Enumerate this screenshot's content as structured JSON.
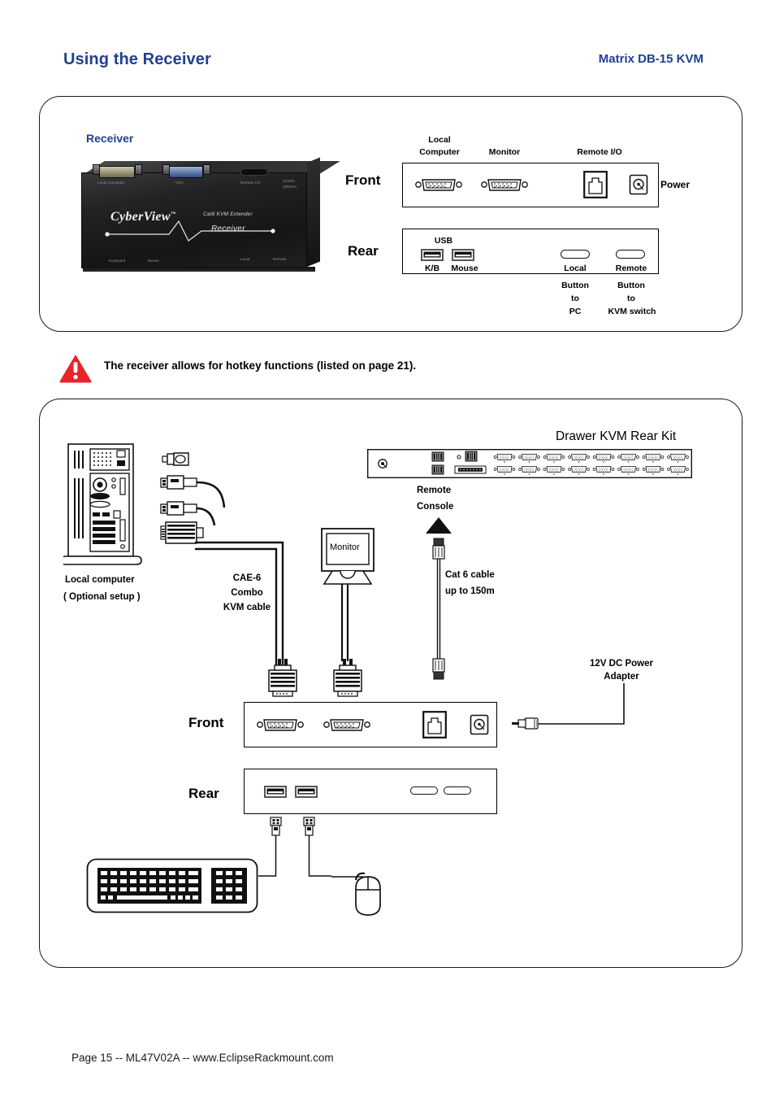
{
  "header": {
    "title": "Using the Receiver",
    "model": "Matrix  DB-15 KVM"
  },
  "receiver_section": {
    "label": "Receiver",
    "photo": {
      "brand": "CyberView",
      "trademark": "™",
      "product_line": "Cat6 KVM Extender",
      "unit_type": "Receiver",
      "port_labels": [
        "Local Computer",
        "VGA",
        "Remote I/O",
        "12VDC 1000mA",
        "K/B",
        "Mouse",
        "Local",
        "Remote"
      ]
    },
    "front": {
      "word": "Front",
      "labels": {
        "local_computer": "Local\nComputer",
        "local_computer_line1": "Local",
        "local_computer_line2": "Computer",
        "monitor": "Monitor",
        "remote_io": "Remote I/O",
        "power": "Power"
      },
      "ports": [
        "db15-local-computer",
        "db15-monitor",
        "rj45-remote-io",
        "power-jack"
      ]
    },
    "rear": {
      "word": "Rear",
      "labels": {
        "usb": "USB",
        "keyboard": "K/B",
        "mouse": "Mouse",
        "local": "Local",
        "remote": "Remote",
        "local_button_l1": "Button",
        "local_button_l2": "to",
        "local_button_l3": "PC",
        "remote_button_l1": "Button",
        "remote_button_l2": "to",
        "remote_button_l3": "KVM switch"
      },
      "ports": [
        "usb-keyboard",
        "usb-mouse",
        "button-local",
        "button-remote"
      ]
    }
  },
  "notice": {
    "icon": "warning-triangle-icon",
    "color": "#e8232a",
    "text": "The receiver allows for hotkey functions (listed on page 21)."
  },
  "diagram": {
    "rear_kit_title": "Drawer KVM Rear Kit",
    "remote_console_l1": "Remote",
    "remote_console_l2": "Console",
    "local_computer_l1": "Local computer",
    "local_computer_l2": "( Optional setup )",
    "kvm_cable_l1": "CAE-6",
    "kvm_cable_l2": "Combo",
    "kvm_cable_l3": "KVM cable",
    "monitor_label": "Monitor",
    "cat6_l1": "Cat 6 cable",
    "cat6_l2": "up to 150m",
    "power_adapter_l1": "12V DC Power",
    "power_adapter_l2": "Adapter",
    "front_word": "Front",
    "rear_word": "Rear",
    "rear_kit_db15_count": 16,
    "rear_kit_rows": 2
  },
  "footer": {
    "text": "Page 15 -- ML47V02A -- www.EclipseRackmount.com"
  }
}
